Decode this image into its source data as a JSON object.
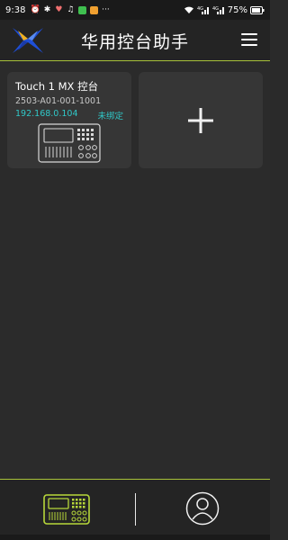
{
  "status_bar": {
    "time": "9:38",
    "battery": "75%",
    "signal_1": "4G",
    "signal_2": "4G"
  },
  "header": {
    "title": "华用控台助手",
    "menu_icon": "hamburger-menu-icon",
    "logo_icon": "brand-logo"
  },
  "devices": [
    {
      "name": "Touch 1 MX 控台",
      "serial": "2503-A01-001-1001",
      "ip": "192.168.0.104",
      "status": "未绑定",
      "icon": "mixing-console-icon"
    }
  ],
  "add_card": {
    "icon": "plus-icon"
  },
  "bottom_nav": {
    "items": [
      {
        "icon": "console-icon",
        "active": true
      },
      {
        "icon": "profile-icon",
        "active": false
      }
    ]
  },
  "colors": {
    "accent": "#a8c23a",
    "ip_text": "#30c8c8",
    "background": "#2b2b2b",
    "card": "#363636"
  }
}
